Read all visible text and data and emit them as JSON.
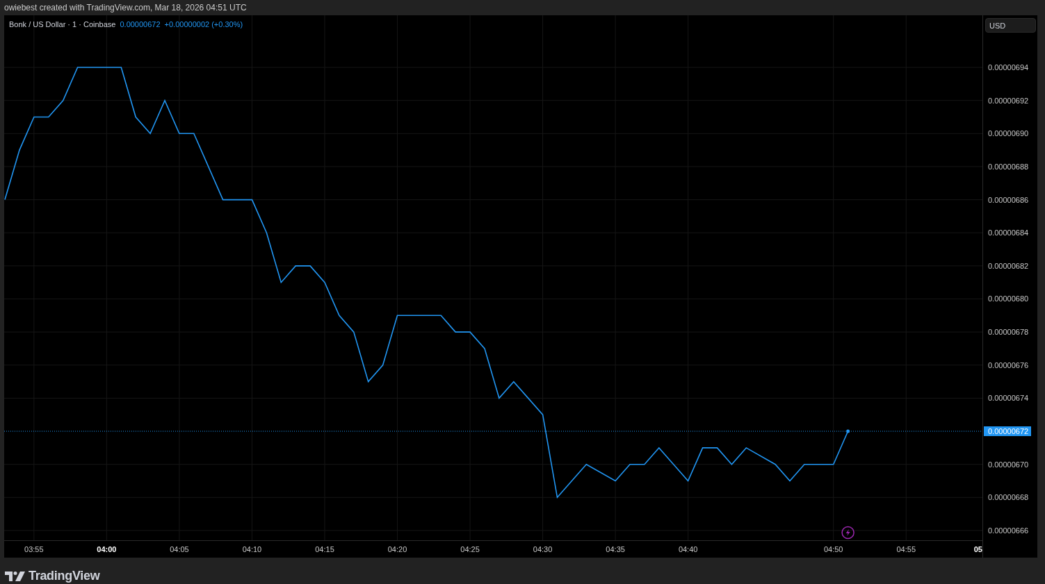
{
  "header": {
    "caption": "owiebest created with TradingView.com, Mar 18, 2026 04:51 UTC"
  },
  "chart": {
    "legend": {
      "symbol": "Bonk / US Dollar · 1 · Coinbase",
      "price": "0.00000672",
      "change": "+0.00000002 (+0.30%)"
    },
    "currency_button": "USD",
    "hour_mark": "05",
    "chart_data": {
      "type": "line",
      "grid": true,
      "x": [
        233,
        234,
        235,
        236,
        237,
        238,
        239,
        240,
        241,
        242,
        243,
        244,
        245,
        246,
        247,
        248,
        249,
        250,
        251,
        252,
        253,
        254,
        255,
        256,
        257,
        258,
        259,
        260,
        261,
        262,
        263,
        264,
        265,
        266,
        267,
        268,
        269,
        270,
        271,
        272,
        273,
        275,
        276,
        277,
        278,
        279,
        280,
        281,
        282,
        283,
        284,
        286,
        287,
        288,
        289,
        290,
        291
      ],
      "series": [
        {
          "color": "#2196f3",
          "values": [
            6.86e-06,
            6.89e-06,
            6.91e-06,
            6.91e-06,
            6.92e-06,
            6.94e-06,
            6.94e-06,
            6.94e-06,
            6.94e-06,
            6.91e-06,
            6.9e-06,
            6.92e-06,
            6.9e-06,
            6.9e-06,
            6.88e-06,
            6.86e-06,
            6.86e-06,
            6.86e-06,
            6.84e-06,
            6.81e-06,
            6.82e-06,
            6.82e-06,
            6.81e-06,
            6.79e-06,
            6.78e-06,
            6.75e-06,
            6.76e-06,
            6.79e-06,
            6.79e-06,
            6.79e-06,
            6.79e-06,
            6.78e-06,
            6.78e-06,
            6.77e-06,
            6.74e-06,
            6.75e-06,
            6.74e-06,
            6.73e-06,
            6.68e-06,
            6.69e-06,
            6.7e-06,
            6.69e-06,
            6.7e-06,
            6.7e-06,
            6.71e-06,
            6.7e-06,
            6.69e-06,
            6.71e-06,
            6.71e-06,
            6.7e-06,
            6.71e-06,
            6.7e-06,
            6.69e-06,
            6.7e-06,
            6.7e-06,
            6.7e-06,
            6.72e-06
          ]
        }
      ],
      "xlim": [
        233,
        300.3
      ],
      "ylim": [
        6.6541e-06,
        6.9715e-06
      ],
      "xticks": [
        {
          "value": 235,
          "label": "03:55"
        },
        {
          "value": 240,
          "label": "04:00"
        },
        {
          "value": 245,
          "label": "04:05"
        },
        {
          "value": 250,
          "label": "04:10"
        },
        {
          "value": 255,
          "label": "04:15"
        },
        {
          "value": 260,
          "label": "04:20"
        },
        {
          "value": 265,
          "label": "04:25"
        },
        {
          "value": 270,
          "label": "04:30"
        },
        {
          "value": 275,
          "label": "04:35"
        },
        {
          "value": 280,
          "label": "04:40"
        },
        {
          "value": 290,
          "label": "04:50"
        },
        {
          "value": 295,
          "label": "04:55"
        }
      ],
      "yticks": [
        {
          "value": 6.94e-06,
          "label": "0.00000694"
        },
        {
          "value": 6.92e-06,
          "label": "0.00000692"
        },
        {
          "value": 6.9e-06,
          "label": "0.00000690"
        },
        {
          "value": 6.88e-06,
          "label": "0.00000688"
        },
        {
          "value": 6.86e-06,
          "label": "0.00000686"
        },
        {
          "value": 6.84e-06,
          "label": "0.00000684"
        },
        {
          "value": 6.82e-06,
          "label": "0.00000682"
        },
        {
          "value": 6.8e-06,
          "label": "0.00000680"
        },
        {
          "value": 6.78e-06,
          "label": "0.00000678"
        },
        {
          "value": 6.76e-06,
          "label": "0.00000676"
        },
        {
          "value": 6.74e-06,
          "label": "0.00000674"
        },
        {
          "value": 6.7e-06,
          "label": "0.00000670"
        },
        {
          "value": 6.68e-06,
          "label": "0.00000668"
        },
        {
          "value": 6.66e-06,
          "label": "0.00000666"
        }
      ],
      "ref_lines": [
        {
          "axis": "y",
          "value": 6.72e-06,
          "label": "0.00000672",
          "color": "#2196f3"
        }
      ]
    }
  },
  "footer": {
    "logo": "TradingView"
  }
}
